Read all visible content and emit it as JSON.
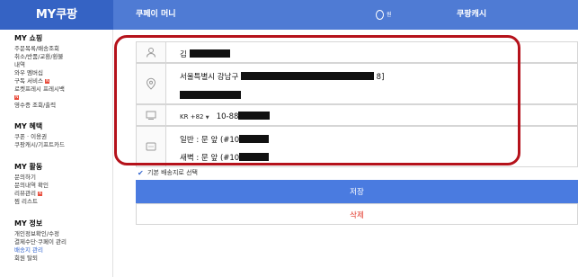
{
  "header": {
    "brand": "MY쿠팡",
    "coupay_money": "쿠페이 머니",
    "cash_value": "0",
    "cash_unit": "원",
    "coupang_cash": "쿠팡캐시"
  },
  "sidebar": {
    "shopping": {
      "title": "MY 쇼핑",
      "items": [
        "주문목록/배송조회",
        "취소/반품/교환/환불",
        "내역",
        "와우 멤버십",
        "구독 서비스",
        "로켓프레시 프레시백",
        "",
        "영수증 조회/출력"
      ],
      "badge": "N"
    },
    "benefits": {
      "title": "MY 혜택",
      "items": [
        "쿠폰 · 이용권",
        "쿠팡캐시/기프트카드"
      ]
    },
    "activity": {
      "title": "MY 활동",
      "items": [
        "문의하기",
        "문의내역 확인",
        "리뷰관리",
        "찜 리스트"
      ]
    },
    "info": {
      "title": "MY 정보",
      "items": [
        "개인정보확인/수정",
        "결제수단·쿠페이 관리",
        "배송지 관리",
        "회원 탈퇴"
      ]
    }
  },
  "form": {
    "name_prefix": "김",
    "address_line1": "서울특별시 강남구",
    "address_suffix": "8]",
    "phone_country": "KR",
    "phone_code": "+82",
    "phone_prefix": "10-88",
    "request_normal": "일반 : 문 앞 (#10",
    "request_dawn": "새벽 : 문 앞 (#10",
    "default_label": "기본 배송지로 선택"
  },
  "buttons": {
    "save": "저장",
    "delete": "삭제"
  },
  "colors": {
    "header": "#4f7bd4",
    "brand_bg": "#3563c4",
    "save": "#4a7be0",
    "delete_text": "#e2382a",
    "highlight": "#b5121b"
  }
}
